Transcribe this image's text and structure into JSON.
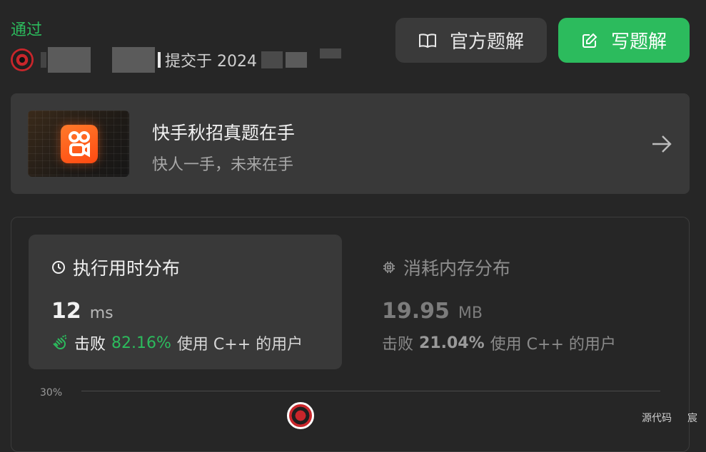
{
  "submission": {
    "status": "通过",
    "submitted_prefix": "提交于 2024"
  },
  "actions": {
    "official_solution": "官方题解",
    "write_solution": "写题解"
  },
  "banner": {
    "title": "快手秋招真题在手",
    "subtitle": "快人一手，未来在手"
  },
  "runtime": {
    "heading": "执行用时分布",
    "value": "12",
    "unit": "ms",
    "beat_label": "击败",
    "beat_pct": "82.16%",
    "suffix": "使用 C++ 的用户"
  },
  "memory": {
    "heading": "消耗内存分布",
    "value": "19.95",
    "unit": "MB",
    "beat_label": "击败",
    "beat_pct": "21.04%",
    "suffix": "使用 C++ 的用户"
  },
  "chart": {
    "y_tick": "30%"
  },
  "footer": {
    "source_code": "源代码",
    "extra": "宸"
  },
  "colors": {
    "accent_green": "#2cbb5d",
    "background": "#262626",
    "card": "#393939"
  }
}
